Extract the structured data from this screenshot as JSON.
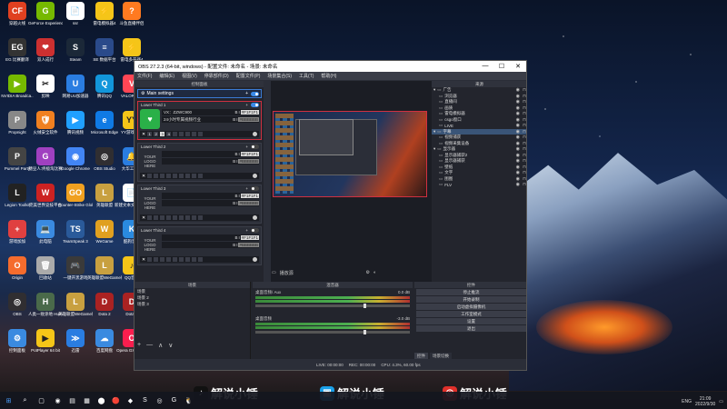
{
  "desktop": {
    "icons": [
      {
        "label": "穿越火线",
        "glyph": "CF",
        "color": "#e04020"
      },
      {
        "label": "GeForce Experience",
        "glyph": "G",
        "color": "#76b900"
      },
      {
        "label": "ssr",
        "glyph": "📄",
        "color": "#ffffff"
      },
      {
        "label": "雷电模拟器4",
        "glyph": "⚡",
        "color": "#f5c518"
      },
      {
        "label": "斗鱼直播伴侣",
        "glyph": "?",
        "color": "#ff7a20"
      },
      {
        "label": "EG 比赛翻译",
        "glyph": "EG",
        "color": "#333333"
      },
      {
        "label": "双人成行",
        "glyph": "❤",
        "color": "#cc3030"
      },
      {
        "label": "Steam",
        "glyph": "S",
        "color": "#1b2838"
      },
      {
        "label": "SE 数据平台",
        "glyph": "≡",
        "color": "#2a4a8a"
      },
      {
        "label": "雷电多开器4",
        "glyph": "⚡",
        "color": "#f5c518"
      },
      {
        "label": "NVIDIA Broadca..",
        "glyph": "▶",
        "color": "#76b900"
      },
      {
        "label": "剪映",
        "glyph": "✂",
        "color": "#ffffff"
      },
      {
        "label": "网易UU加速器",
        "glyph": "U",
        "color": "#2a7de1"
      },
      {
        "label": "腾讯QQ",
        "glyph": "Q",
        "color": "#1296db"
      },
      {
        "label": "VALORANT",
        "glyph": "V",
        "color": "#ff4655"
      },
      {
        "label": "Propnight",
        "glyph": "P",
        "color": "#888888"
      },
      {
        "label": "火绒安全软件",
        "glyph": "🛡",
        "color": "#f08020"
      },
      {
        "label": "腾讯视频",
        "glyph": "▶",
        "color": "#20a0ff"
      },
      {
        "label": "Microsoft Edge",
        "glyph": "e",
        "color": "#0f7ae5"
      },
      {
        "label": "YY游戏大厅",
        "glyph": "YY",
        "color": "#f5c518"
      },
      {
        "label": "Pummel Party",
        "glyph": "P",
        "color": "#444444"
      },
      {
        "label": "糖豆人:终极淘汰赛",
        "glyph": "G",
        "color": "#a040c0"
      },
      {
        "label": "Google Chrome",
        "glyph": "◉",
        "color": "#4285f4"
      },
      {
        "label": "OBS Studio",
        "glyph": "◎",
        "color": "#302e31"
      },
      {
        "label": "大华工作台",
        "glyph": "🔔",
        "color": "#2a7de1"
      },
      {
        "label": "Legion Toolkit",
        "glyph": "L",
        "color": "#222222"
      },
      {
        "label": "完美世界竞技平台",
        "glyph": "W",
        "color": "#cc2222"
      },
      {
        "label": "Counter-Strike Global Off..",
        "glyph": "GO",
        "color": "#f0a020"
      },
      {
        "label": "英雄联盟",
        "glyph": "L",
        "color": "#c8a040"
      },
      {
        "label": "新建文本文档(2021/0..",
        "glyph": "📄",
        "color": "#ffffff"
      },
      {
        "label": "游戏加加",
        "glyph": "+",
        "color": "#e04040"
      },
      {
        "label": "此电脑",
        "glyph": "💻",
        "color": "#3a8ae0"
      },
      {
        "label": "TeamSpeak 3",
        "glyph": "TS",
        "color": "#2a5a9a"
      },
      {
        "label": "WeGame",
        "glyph": "W",
        "color": "#e0a020"
      },
      {
        "label": "酷狗音乐",
        "glyph": "K",
        "color": "#2a8ae0"
      },
      {
        "label": "Origin",
        "glyph": "O",
        "color": "#f56c2d"
      },
      {
        "label": "回收站",
        "glyph": "🗑",
        "color": "#aaaaaa"
      },
      {
        "label": "一键开黑游戏",
        "glyph": "🎮",
        "color": "#3a3a3a"
      },
      {
        "label": "英雄联盟WeGame版",
        "glyph": "L",
        "color": "#c8a040"
      },
      {
        "label": "QQ音乐",
        "glyph": "♪",
        "color": "#f5c518"
      },
      {
        "label": "OBS",
        "glyph": "◎",
        "color": "#302e31"
      },
      {
        "label": "人类一败涂地 Human Fal..",
        "glyph": "H",
        "color": "#4a6a4a"
      },
      {
        "label": "英雄联盟WeGame版",
        "glyph": "L",
        "color": "#c8a040"
      },
      {
        "label": "Dota 2",
        "glyph": "D",
        "color": "#aa2222"
      },
      {
        "label": "Dota 2",
        "glyph": "D",
        "color": "#aa2222"
      },
      {
        "label": "控制面板",
        "glyph": "⚙",
        "color": "#3a8ae0"
      },
      {
        "label": "PotPlayer 64 bit",
        "glyph": "▶",
        "color": "#f5c518"
      },
      {
        "label": "迅雷",
        "glyph": "≫",
        "color": "#2a7de1"
      },
      {
        "label": "百度网盘",
        "glyph": "☁",
        "color": "#3a8ae0"
      },
      {
        "label": "Opera GX浏览器",
        "glyph": "O",
        "color": "#fa1e4e"
      }
    ]
  },
  "obs": {
    "title": "OBS 27.2.3 (64-bit, windows) - 配置文件: 未命名 - 场景: 未命名",
    "window_controls": [
      "—",
      "☐",
      "✕"
    ],
    "menu": [
      "文件(F)",
      "编辑(E)",
      "视图(V)",
      "停靠部件(D)",
      "配置文件(P)",
      "场景集合(S)",
      "工具(T)",
      "帮助(H)"
    ],
    "lower_third_dock": {
      "title": "控制面板",
      "main_settings": "Main settings",
      "items": [
        {
          "name": "Lower Third 1",
          "logo": "♥",
          "line1": "VX：ZZWC900",
          "line2": "24小时专属视频行业",
          "active": true
        },
        {
          "name": "Lower Third 2",
          "logo": "YOUR LOGO HERE",
          "line1": "",
          "line2": "",
          "active": false
        },
        {
          "name": "Lower Third 3",
          "logo": "YOUR LOGO HERE",
          "line1": "",
          "line2": "",
          "active": false
        },
        {
          "name": "Lower Third 4",
          "logo": "YOUR LOGO HERE",
          "line1": "",
          "line2": "",
          "active": false
        }
      ],
      "hotkey_a": "#F1F1F1",
      "hotkey_b": "#BBBBBB",
      "bold_label": "B",
      "italic_label": "I",
      "close_label": "✕",
      "footer_digits": [
        "1",
        "2",
        "3",
        "4"
      ]
    },
    "preview_bar_label": "播放源",
    "sources": {
      "title": "来源",
      "items": [
        {
          "label": "广告",
          "type": "group",
          "selected": false
        },
        {
          "label": "浏览器",
          "type": "item",
          "selected": false
        },
        {
          "label": "直播间",
          "type": "item",
          "selected": false
        },
        {
          "label": "画质",
          "type": "item",
          "selected": false
        },
        {
          "label": "雷电模拟器",
          "type": "item",
          "selected": false
        },
        {
          "label": "csgo窗口",
          "type": "item",
          "selected": false
        },
        {
          "label": "LIVE",
          "type": "item",
          "selected": false
        },
        {
          "label": "字幕",
          "type": "group",
          "selected": true
        },
        {
          "label": "视频捕获",
          "type": "item",
          "selected": false
        },
        {
          "label": "视频采集设备",
          "type": "item",
          "selected": false
        },
        {
          "label": "显示器",
          "type": "group",
          "selected": false
        },
        {
          "label": "显示器捕获2",
          "type": "item",
          "selected": false
        },
        {
          "label": "显示器捕获",
          "type": "item",
          "selected": false
        },
        {
          "label": "壁纸",
          "type": "item",
          "selected": false
        },
        {
          "label": "文字",
          "type": "item",
          "selected": false
        },
        {
          "label": "图图",
          "type": "item",
          "selected": false
        },
        {
          "label": "FLV",
          "type": "item",
          "selected": false
        }
      ],
      "footer": [
        "+",
        "—",
        "⚙",
        "∧",
        "∨"
      ]
    },
    "scenes": {
      "title": "场景",
      "items": [
        "场景",
        "场景 2",
        "场景 3"
      ],
      "footer": [
        "+",
        "—",
        "∧",
        "∨"
      ]
    },
    "mixer": {
      "title": "混音器",
      "channels": [
        {
          "name": "桌面音频/ Aux",
          "db": "0.0 dB"
        },
        {
          "name": "桌面音频",
          "db": "-3.0 dB"
        }
      ]
    },
    "controls": {
      "title": "控件",
      "buttons": [
        "停止推流",
        "开始录制",
        "启动虚拟摄像机",
        "工作室模式",
        "设置",
        "退出"
      ],
      "tabs": [
        "控件",
        "场景切换"
      ]
    },
    "status": {
      "items": [
        "LIVE: 00:00:00",
        "REC: 00:00:00",
        "CPU: 4.3%, 60.00 fps"
      ]
    }
  },
  "watermarks": [
    {
      "text": "解说小锤",
      "glyph": "♪",
      "color": "#111111"
    },
    {
      "text": "解说小锤",
      "glyph": "▣",
      "color": "#1aa0e8"
    },
    {
      "text": "解说小锤",
      "glyph": "◎",
      "color": "#e0302a"
    }
  ],
  "taskbar": {
    "start": "⊞",
    "search": "⌕",
    "task_view": "▢",
    "apps": [
      "◉",
      "▤",
      "▦",
      "⬤",
      "🔴",
      "◆",
      "S",
      "◎",
      "G",
      "🐧"
    ],
    "tray": {
      "lang": "ENG",
      "time": "21:09",
      "date": "2022/9/30"
    }
  }
}
